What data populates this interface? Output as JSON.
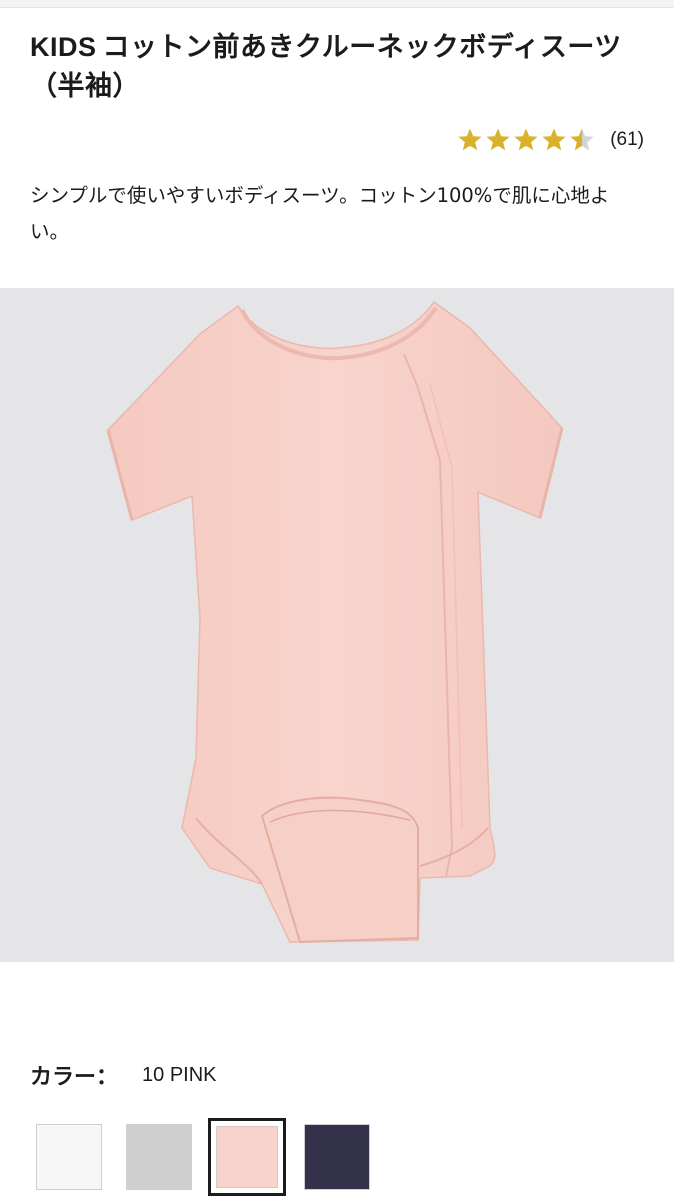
{
  "product": {
    "brand": "KIDS",
    "name": "コットン前あきクルーネックボディスーツ（半袖）",
    "description": "シンプルで使いやすいボディスーツ。コットン100%で肌に心地よい。"
  },
  "rating": {
    "score": 4.5,
    "max": 5,
    "count_label": "(61)",
    "star_color": "#d9b12a",
    "empty_color": "#d3d3d3"
  },
  "gallery": {
    "current": "1",
    "total": "3",
    "background": "#e5e5e7",
    "garment_color": "#f7d1c9"
  },
  "color_selector": {
    "label": "カラー：",
    "selected_value": "10 PINK",
    "swatches": [
      {
        "name": "white",
        "hex": "#f7f7f7",
        "selected": false
      },
      {
        "name": "gray",
        "hex": "#cfcfcf",
        "selected": false
      },
      {
        "name": "pink",
        "hex": "#f8d3cb",
        "selected": true
      },
      {
        "name": "navy",
        "hex": "#33324a",
        "selected": false
      }
    ]
  }
}
